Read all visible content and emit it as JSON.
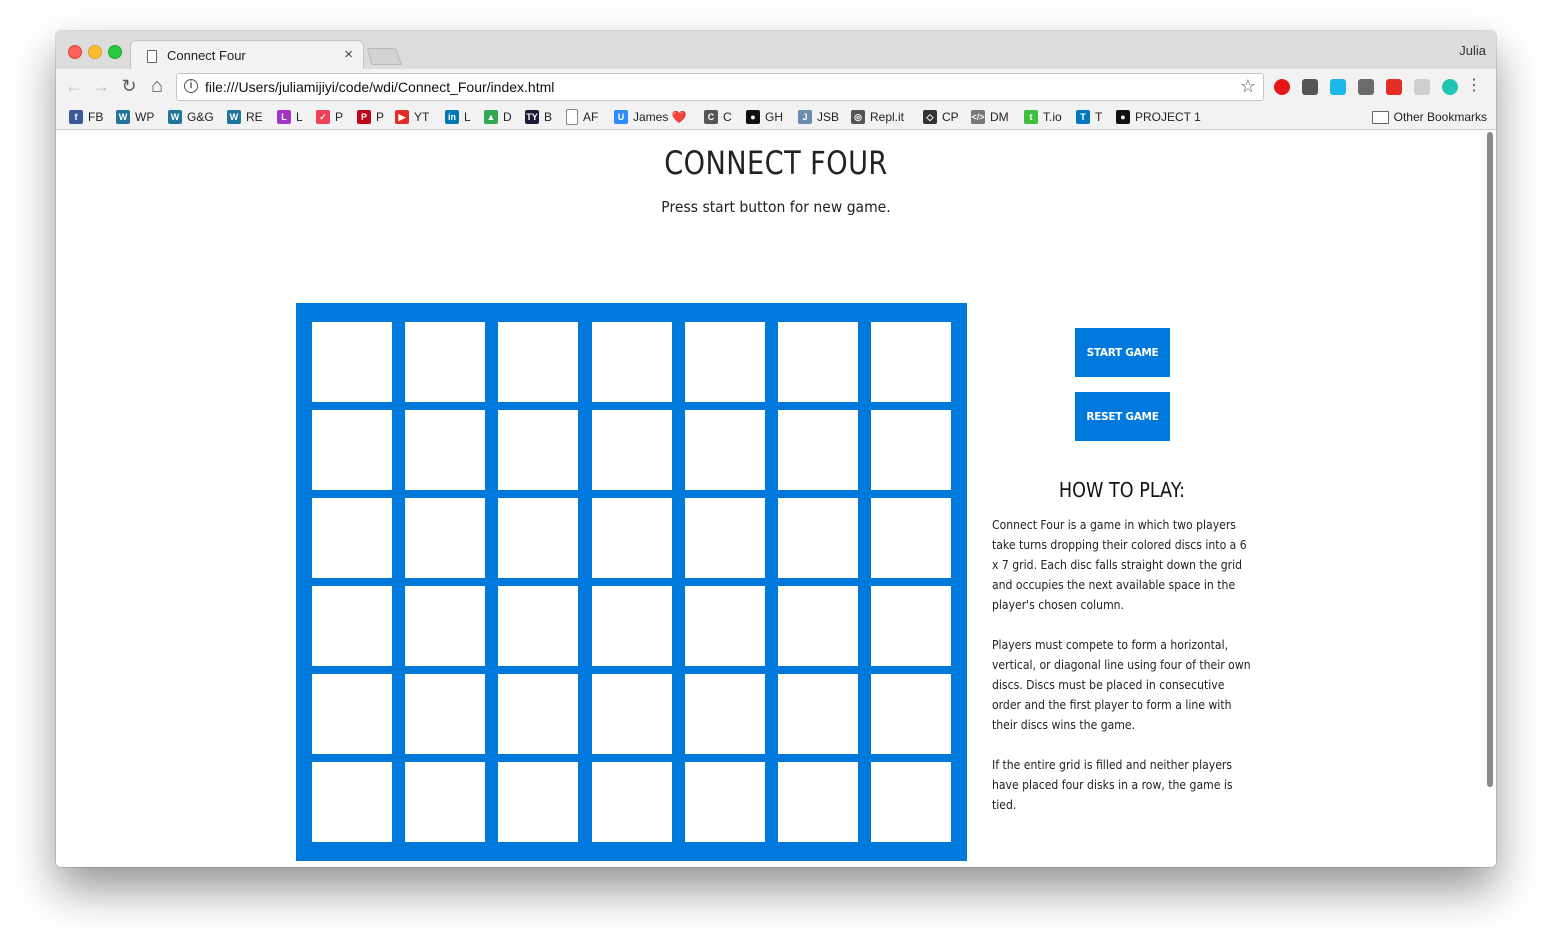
{
  "browser": {
    "tab_title": "Connect Four",
    "tab_close": "×",
    "profile_name": "Julia",
    "url": "file:///Users/juliamijiyi/code/wdi/Connect_Four/index.html",
    "nav_icons": {
      "back": "←",
      "forward": "→",
      "reload": "↻",
      "home": "⌂"
    },
    "star_glyph": "☆",
    "info_glyph": "i",
    "menu_glyph": "⋮",
    "extensions": [
      {
        "name": "opera-icon",
        "color": "#e2161b"
      },
      {
        "name": "pocket-icon",
        "color": "#555555"
      },
      {
        "name": "vimeo-icon",
        "color": "#1ab7ea"
      },
      {
        "name": "ghostery-icon",
        "color": "#6b6b6b"
      },
      {
        "name": "video-icon",
        "color": "#e52d27"
      },
      {
        "name": "grey-extension-icon",
        "color": "#cfcfcf"
      },
      {
        "name": "m-extension-icon",
        "color": "#1fc6b4"
      }
    ]
  },
  "bookmarks": [
    {
      "label": "FB",
      "icon": "facebook-icon",
      "color": "#3b5998",
      "glyph": "f"
    },
    {
      "label": "WP",
      "icon": "wordpress-icon",
      "color": "#21759b",
      "glyph": "W"
    },
    {
      "label": "G&G",
      "icon": "wordpress-icon",
      "color": "#21759b",
      "glyph": "W"
    },
    {
      "label": "RE",
      "icon": "wordpress-icon",
      "color": "#21759b",
      "glyph": "W"
    },
    {
      "label": "L",
      "icon": "l-icon",
      "color": "#a335c5",
      "glyph": "L"
    },
    {
      "label": "P",
      "icon": "pocket-icon",
      "color": "#ef4056",
      "glyph": "✓"
    },
    {
      "label": "P",
      "icon": "pinterest-icon",
      "color": "#bd081c",
      "glyph": "P"
    },
    {
      "label": "YT",
      "icon": "youtube-icon",
      "color": "#e52d27",
      "glyph": "▶"
    },
    {
      "label": "L",
      "icon": "linkedin-icon",
      "color": "#0077b5",
      "glyph": "in"
    },
    {
      "label": "D",
      "icon": "drive-icon",
      "color": "#34a853",
      "glyph": "▲"
    },
    {
      "label": "B",
      "icon": "ty-icon",
      "color": "#1c1c3a",
      "glyph": "TY"
    },
    {
      "label": "AF",
      "icon": "page-icon",
      "color": "#9e9e9e",
      "glyph": ""
    },
    {
      "label": "James ❤️",
      "icon": "u-icon",
      "color": "#2d8cff",
      "glyph": "U"
    },
    {
      "label": "C",
      "icon": "c-icon",
      "color": "#555555",
      "glyph": "C"
    },
    {
      "label": "GH",
      "icon": "github-icon",
      "color": "#111111",
      "glyph": "●"
    },
    {
      "label": "JSB",
      "icon": "jsbin-icon",
      "color": "#6a8caf",
      "glyph": "J"
    },
    {
      "label": "Repl.it",
      "icon": "replit-icon",
      "color": "#555555",
      "glyph": "◎"
    },
    {
      "label": "CP",
      "icon": "codepen-icon",
      "color": "#333333",
      "glyph": "◇"
    },
    {
      "label": "DM",
      "icon": "code-icon",
      "color": "#777777",
      "glyph": "</>"
    },
    {
      "label": "T.io",
      "icon": "t-icon",
      "color": "#3fbf3f",
      "glyph": "t"
    },
    {
      "label": "T",
      "icon": "trello-icon",
      "color": "#0079bf",
      "glyph": "T"
    },
    {
      "label": "PROJECT 1",
      "icon": "github-icon",
      "color": "#111111",
      "glyph": "●"
    }
  ],
  "other_bookmarks": "Other Bookmarks",
  "page": {
    "title": "CONNECT FOUR",
    "subtitle": "Press start button for new game.",
    "board": {
      "rows": 6,
      "columns": 7,
      "color": "#0079dc"
    },
    "start_button": "START GAME",
    "reset_button": "RESET GAME",
    "howto_heading": "HOW TO PLAY:",
    "howto_paragraphs": [
      "Connect Four is a game in which two players take turns dropping their colored discs into a 6 x 7 grid. Each disc falls straight down the grid and occupies the next available space in the player's chosen column.",
      "Players must compete to form a horizontal, vertical, or diagonal line using four of their own discs. Discs must be placed in consecutive order and the first player to form a line with their discs wins the game.",
      "If the entire grid is filled and neither players have placed four disks in a row, the game is tied."
    ]
  }
}
